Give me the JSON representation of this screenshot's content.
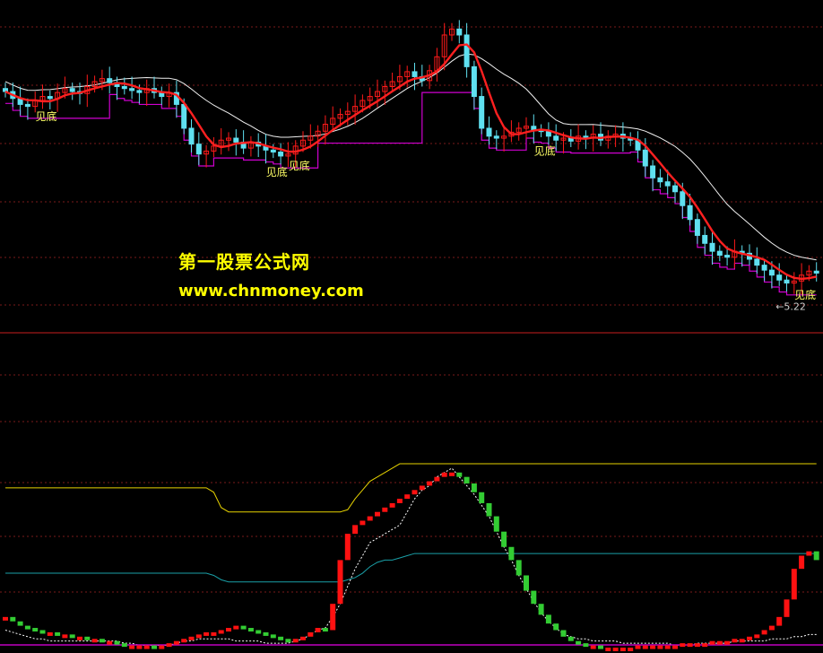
{
  "watermark": {
    "title": "第一股票公式网",
    "url": "www.chnmoney.com"
  },
  "colors": {
    "bg": "#000000",
    "grid": "#7a1a1a",
    "divider": "#c81e1e",
    "up": "#ff1a1a",
    "down": "#5fe0f0",
    "ma_red": "#ff2020",
    "ma_white": "#f0f0f0",
    "support": "#d000d0",
    "label": "#ffff66",
    "sub_up": "#ff1111",
    "sub_down": "#33cc33",
    "sub_yellow": "#e6d200",
    "sub_cyan": "#1aa0a8",
    "sub_white": "#ffffff",
    "sub_magenta": "#c000c0"
  },
  "chart_data": [
    {
      "type": "candlestick",
      "panel": "main",
      "ylim": [
        5.0,
        8.2
      ],
      "x_count": 110,
      "min_marker": {
        "index": 104,
        "value": 5.22,
        "label": "←5.22"
      },
      "signals": [
        {
          "index": 5,
          "text": "见底"
        },
        {
          "index": 36,
          "text": "见底"
        },
        {
          "index": 39,
          "text": "见底"
        },
        {
          "index": 72,
          "text": "见底"
        },
        {
          "index": 107,
          "text": "见底"
        }
      ],
      "closes": [
        7.35,
        7.28,
        7.22,
        7.2,
        7.26,
        7.3,
        7.28,
        7.34,
        7.38,
        7.35,
        7.33,
        7.4,
        7.45,
        7.48,
        7.44,
        7.4,
        7.38,
        7.36,
        7.34,
        7.38,
        7.34,
        7.3,
        7.34,
        7.22,
        6.98,
        6.82,
        6.72,
        6.75,
        6.8,
        6.86,
        6.88,
        6.84,
        6.78,
        6.84,
        6.8,
        6.76,
        6.74,
        6.7,
        6.72,
        6.8,
        6.86,
        6.9,
        6.95,
        7.02,
        7.08,
        7.12,
        7.15,
        7.2,
        7.26,
        7.3,
        7.35,
        7.4,
        7.45,
        7.5,
        7.55,
        7.5,
        7.46,
        7.56,
        7.7,
        7.92,
        7.98,
        7.92,
        7.6,
        7.3,
        6.98,
        6.9,
        6.88,
        6.9,
        6.94,
        6.98,
        7.0,
        6.96,
        6.95,
        6.9,
        6.86,
        6.88,
        6.85,
        6.9,
        6.88,
        6.92,
        6.86,
        6.9,
        6.92,
        6.88,
        6.86,
        6.76,
        6.6,
        6.48,
        6.44,
        6.4,
        6.34,
        6.2,
        6.06,
        5.9,
        5.82,
        5.74,
        5.7,
        5.68,
        5.74,
        5.72,
        5.66,
        5.6,
        5.55,
        5.5,
        5.45,
        5.42,
        5.44,
        5.5,
        5.54,
        5.52
      ]
    },
    {
      "type": "oscillator",
      "panel": "sub",
      "ylim": [
        0,
        100
      ],
      "x_count": 110,
      "values": [
        14,
        12,
        10,
        9,
        8,
        7,
        7,
        6,
        6,
        5,
        5,
        4,
        4,
        3,
        3,
        2,
        1,
        1,
        1,
        1,
        0,
        1,
        2,
        3,
        4,
        5,
        6,
        7,
        7,
        8,
        9,
        10,
        9,
        8,
        7,
        6,
        5,
        4,
        3,
        4,
        5,
        7,
        9,
        8,
        20,
        40,
        52,
        56,
        58,
        60,
        62,
        64,
        66,
        68,
        70,
        72,
        74,
        76,
        78,
        80,
        80,
        78,
        75,
        71,
        66,
        60,
        53,
        46,
        40,
        33,
        26,
        20,
        15,
        11,
        8,
        5,
        3,
        2,
        1,
        1,
        0,
        0,
        0,
        0,
        0,
        1,
        1,
        1,
        1,
        1,
        1,
        2,
        2,
        2,
        2,
        3,
        3,
        3,
        4,
        4,
        5,
        6,
        8,
        10,
        14,
        22,
        36,
        42,
        44,
        40
      ],
      "upper": [
        73,
        73,
        73,
        73,
        73,
        73,
        73,
        73,
        73,
        73,
        73,
        73,
        73,
        73,
        73,
        73,
        73,
        73,
        73,
        73,
        73,
        73,
        73,
        73,
        73,
        73,
        73,
        73,
        71,
        64,
        62,
        62,
        62,
        62,
        62,
        62,
        62,
        62,
        62,
        62,
        62,
        62,
        62,
        62,
        62,
        62,
        63,
        68,
        72,
        76,
        78,
        80,
        82,
        84,
        84,
        84,
        84,
        84,
        84,
        84,
        84,
        84,
        84,
        84,
        84,
        84,
        84,
        84,
        84,
        84,
        84,
        84,
        84,
        84,
        84,
        84,
        84,
        84,
        84,
        84,
        84,
        84,
        84,
        84,
        84,
        84,
        84,
        84,
        84,
        84,
        84,
        84,
        84,
        84,
        84,
        84,
        84,
        84,
        84,
        84,
        84,
        84,
        84,
        84,
        84,
        84,
        84,
        84,
        84,
        84
      ],
      "mid": [
        34,
        34,
        34,
        34,
        34,
        34,
        34,
        34,
        34,
        34,
        34,
        34,
        34,
        34,
        34,
        34,
        34,
        34,
        34,
        34,
        34,
        34,
        34,
        34,
        34,
        34,
        34,
        34,
        33,
        31,
        30,
        30,
        30,
        30,
        30,
        30,
        30,
        30,
        30,
        30,
        30,
        30,
        30,
        30,
        30,
        30,
        31,
        32,
        34,
        37,
        39,
        40,
        40,
        41,
        42,
        43,
        43,
        43,
        43,
        43,
        43,
        43,
        43,
        43,
        43,
        43,
        43,
        43,
        43,
        43,
        43,
        43,
        43,
        43,
        43,
        43,
        43,
        43,
        43,
        43,
        43,
        43,
        43,
        43,
        43,
        43,
        43,
        43,
        43,
        43,
        43,
        43,
        43,
        43,
        43,
        43,
        43,
        43,
        43,
        43,
        43,
        43,
        43,
        43,
        43,
        43,
        43,
        43,
        43,
        43
      ],
      "dotted": [
        8,
        7,
        6,
        5,
        4,
        4,
        3,
        3,
        3,
        3,
        3,
        3,
        3,
        3,
        3,
        3,
        2,
        2,
        1,
        1,
        1,
        1,
        1,
        2,
        3,
        3,
        4,
        4,
        4,
        4,
        4,
        3,
        3,
        3,
        3,
        2,
        2,
        2,
        2,
        3,
        4,
        6,
        8,
        9,
        14,
        20,
        28,
        36,
        42,
        48,
        50,
        52,
        54,
        56,
        62,
        68,
        72,
        74,
        78,
        80,
        82,
        78,
        74,
        70,
        65,
        60,
        53,
        46,
        40,
        33,
        27,
        21,
        16,
        12,
        9,
        6,
        5,
        4,
        4,
        3,
        3,
        3,
        3,
        2,
        2,
        2,
        2,
        2,
        2,
        2,
        1,
        1,
        1,
        2,
        2,
        2,
        2,
        2,
        3,
        3,
        3,
        3,
        3,
        4,
        4,
        4,
        5,
        5,
        6,
        6
      ]
    }
  ]
}
